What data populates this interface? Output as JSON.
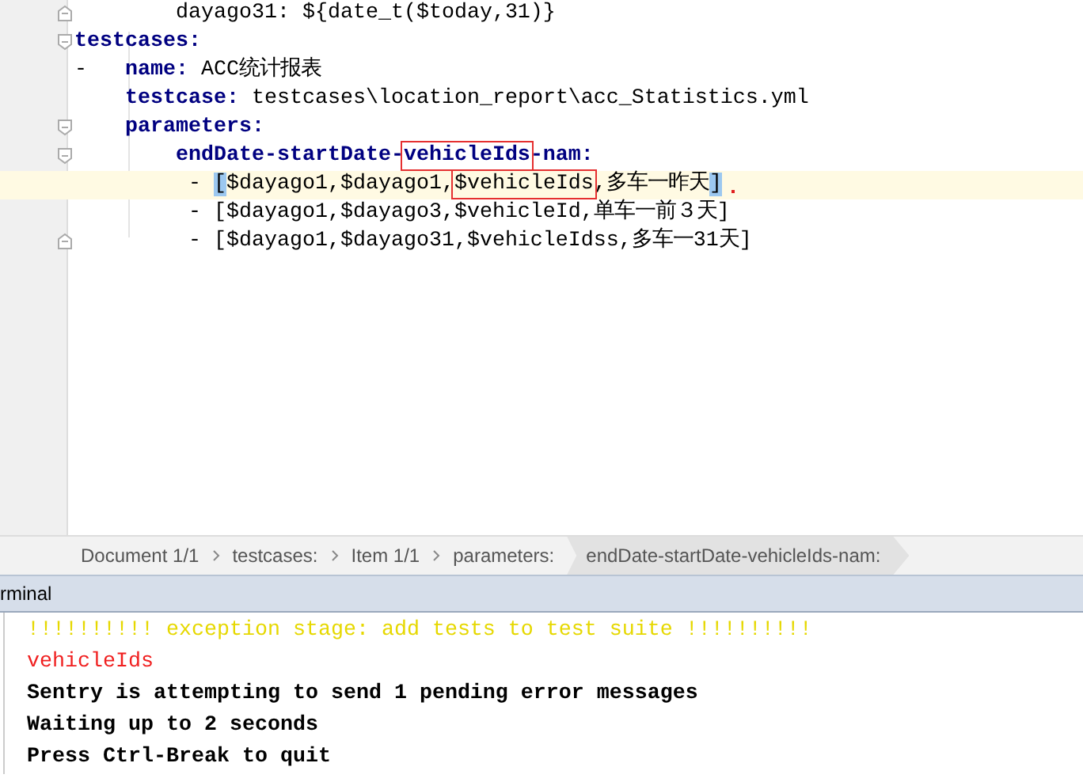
{
  "editor": {
    "lines": [
      {
        "fold_end": true,
        "current": false,
        "segments": [
          {
            "text": "        dayago31: ${date_t($today,31)}",
            "kind": "value"
          }
        ]
      },
      {
        "fold_start": true,
        "current": false,
        "segments": [
          {
            "text": "testcases:",
            "kind": "key"
          }
        ]
      },
      {
        "current": false,
        "segments": [
          {
            "text": "-   ",
            "kind": "value"
          },
          {
            "text": "name:",
            "kind": "key"
          },
          {
            "text": " ACC统计报表",
            "kind": "value"
          }
        ]
      },
      {
        "current": false,
        "segments": [
          {
            "text": "    testcase:",
            "kind": "key"
          },
          {
            "text": " testcases\\location_report\\acc_Statistics.yml",
            "kind": "value"
          }
        ]
      },
      {
        "fold_start": true,
        "current": false,
        "segments": [
          {
            "text": "    parameters:",
            "kind": "key"
          }
        ]
      },
      {
        "fold_start": true,
        "current": false,
        "segments": [
          {
            "text": "        endDate-startDate-",
            "kind": "key"
          },
          {
            "text": "vehicleIds",
            "kind": "key",
            "boxed": true
          },
          {
            "text": "-nam:",
            "kind": "key"
          }
        ]
      },
      {
        "current": true,
        "error_mark": true,
        "segments": [
          {
            "text": "         - ",
            "kind": "value"
          },
          {
            "text": "[",
            "kind": "value",
            "matched": true
          },
          {
            "text": "$dayago1,$dayago1,",
            "kind": "value"
          },
          {
            "text": "$vehicleIds",
            "kind": "value",
            "boxed": true
          },
          {
            "text": ",多车一昨天",
            "kind": "value"
          },
          {
            "text": "]",
            "kind": "value",
            "matched": true
          }
        ]
      },
      {
        "current": false,
        "segments": [
          {
            "text": "         - [$dayago1,$dayago3,$vehicleId,单车一前３天]",
            "kind": "value"
          }
        ]
      },
      {
        "fold_end": true,
        "current": false,
        "segments": [
          {
            "text": "         - [$dayago1,$dayago31,$vehicleIdss,多车一31天]",
            "kind": "value"
          }
        ]
      }
    ]
  },
  "breadcrumbs": [
    {
      "label": "Document 1/1",
      "selected": false
    },
    {
      "label": "testcases:",
      "selected": false
    },
    {
      "label": "Item 1/1",
      "selected": false
    },
    {
      "label": "parameters:",
      "selected": false
    },
    {
      "label": "endDate-startDate-vehicleIds-nam:",
      "selected": true
    }
  ],
  "terminal": {
    "title": "rminal",
    "lines": [
      {
        "text": "!!!!!!!!!! exception stage: add tests to test suite !!!!!!!!!!",
        "kind": "warning"
      },
      {
        "text": "vehicleIds",
        "kind": "error"
      },
      {
        "text": "Sentry is attempting to send 1 pending error messages",
        "kind": "plain"
      },
      {
        "text": "Waiting up to 2 seconds",
        "kind": "plain"
      },
      {
        "text": "Press Ctrl-Break to quit",
        "kind": "plain"
      }
    ]
  }
}
